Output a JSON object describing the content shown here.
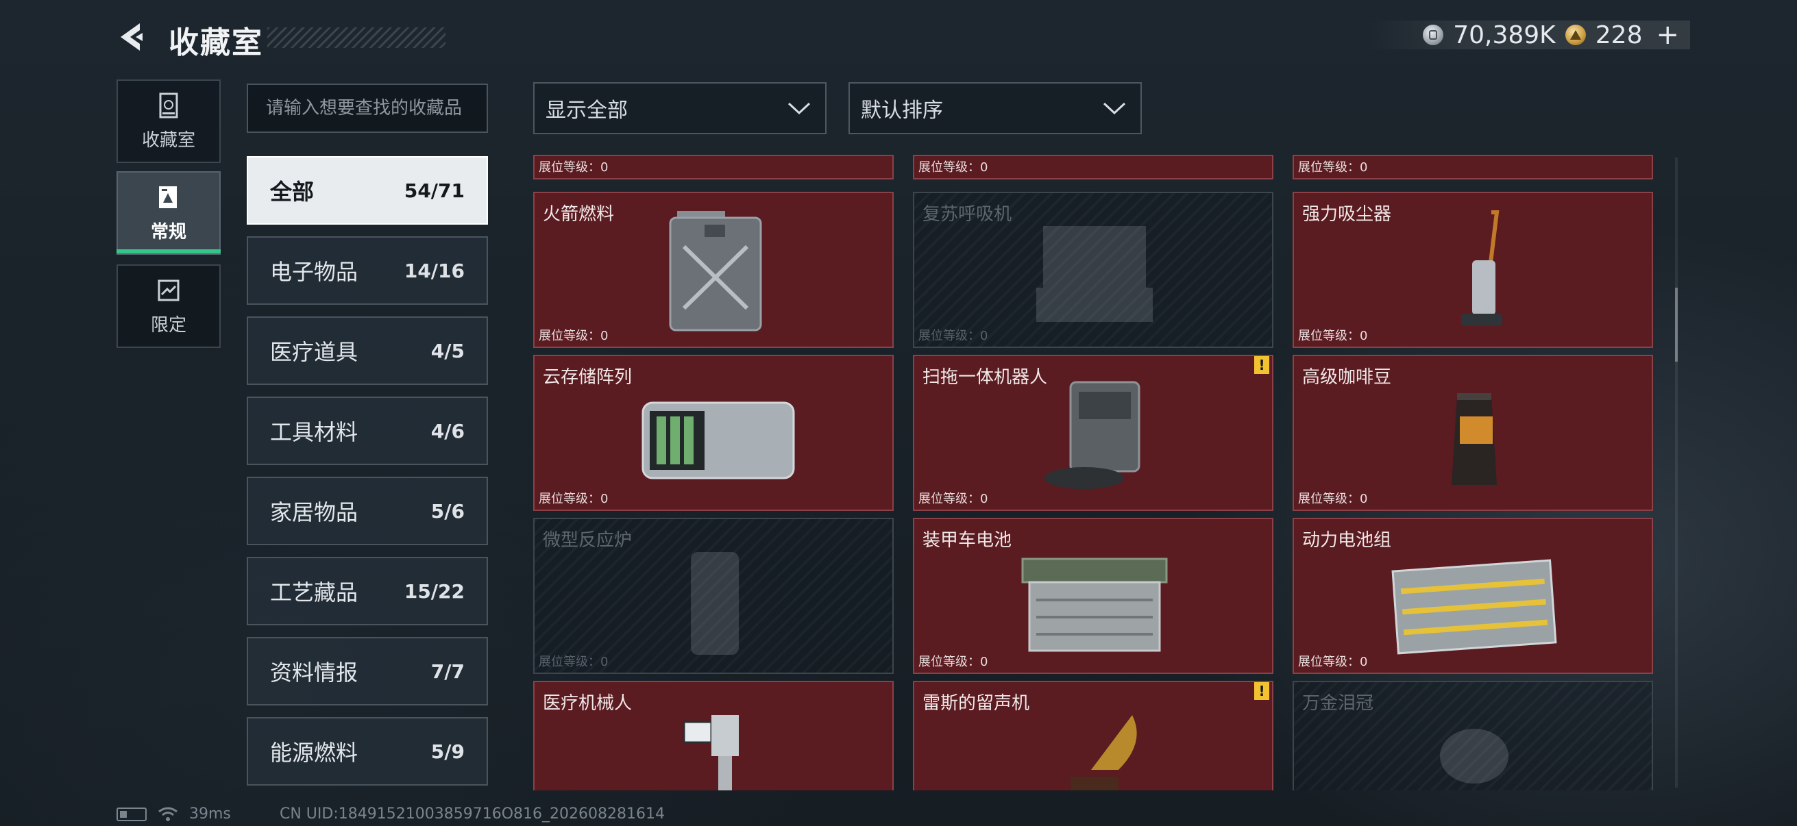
{
  "header": {
    "title": "收藏室",
    "silver_amount": "70,389K",
    "gold_amount": "228",
    "plus_symbol": "+"
  },
  "nav": [
    {
      "label": "收藏室",
      "icon": "collection-icon"
    },
    {
      "label": "常规",
      "icon": "normal-icon",
      "active": true
    },
    {
      "label": "限定",
      "icon": "limited-icon"
    }
  ],
  "search": {
    "placeholder": "请输入想要查找的收藏品"
  },
  "filters": {
    "display": "显示全部",
    "sort": "默认排序"
  },
  "categories": [
    {
      "label": "全部",
      "count": "54/71",
      "active": true
    },
    {
      "label": "电子物品",
      "count": "14/16"
    },
    {
      "label": "医疗道具",
      "count": "4/5"
    },
    {
      "label": "工具材料",
      "count": "4/6"
    },
    {
      "label": "家居物品",
      "count": "5/6"
    },
    {
      "label": "工艺藏品",
      "count": "15/22"
    },
    {
      "label": "资料情报",
      "count": "7/7"
    },
    {
      "label": "能源燃料",
      "count": "5/9"
    }
  ],
  "level_label": "展位等级：0",
  "items": [
    {
      "name": "火箭燃料",
      "art": "fuel-can-icon",
      "owned": true,
      "alert": false
    },
    {
      "name": "复苏呼吸机",
      "art": "ventilator-icon",
      "owned": false,
      "alert": false
    },
    {
      "name": "强力吸尘器",
      "art": "vacuum-icon",
      "owned": true,
      "alert": false
    },
    {
      "name": "云存储阵列",
      "art": "storage-array-icon",
      "owned": true,
      "alert": false
    },
    {
      "name": "扫拖一体机器人",
      "art": "robot-vacuum-icon",
      "owned": true,
      "alert": true
    },
    {
      "name": "高级咖啡豆",
      "art": "coffee-bag-icon",
      "owned": true,
      "alert": false
    },
    {
      "name": "微型反应炉",
      "art": "reactor-icon",
      "owned": false,
      "alert": false
    },
    {
      "name": "装甲车电池",
      "art": "car-battery-icon",
      "owned": true,
      "alert": false
    },
    {
      "name": "动力电池组",
      "art": "battery-pack-icon",
      "owned": true,
      "alert": false
    },
    {
      "name": "医疗机械人",
      "art": "medical-robot-icon",
      "owned": true,
      "alert": false
    },
    {
      "name": "雷斯的留声机",
      "art": "gramophone-icon",
      "owned": true,
      "alert": true
    },
    {
      "name": "万金泪冠",
      "art": "crown-icon",
      "owned": false,
      "alert": false
    }
  ],
  "alert_symbol": "!",
  "footer": {
    "ping": "39ms",
    "uid": "CN UID:18491521003859716O816_202608281614"
  }
}
